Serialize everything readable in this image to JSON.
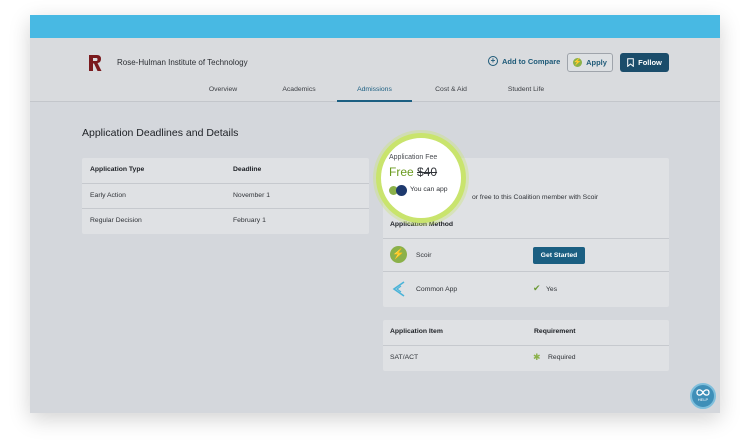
{
  "header": {
    "school_name": "Rose-Hulman Institute of Technology",
    "add_to_compare": "Add to Compare",
    "apply": "Apply",
    "follow": "Follow"
  },
  "tabs": [
    "Overview",
    "Academics",
    "Admissions",
    "Cost & Aid",
    "Student Life"
  ],
  "active_tab": "Admissions",
  "section_title": "Application Deadlines and Details",
  "deadlines": {
    "headers": [
      "Application Type",
      "Deadline"
    ],
    "rows": [
      [
        "Early Action",
        "November 1"
      ],
      [
        "Regular Decision",
        "February 1"
      ]
    ]
  },
  "fee": {
    "label": "Application Fee",
    "free": "Free",
    "old_price": "$40",
    "note_visible": "You can app",
    "note_rest": "or free to this Coalition member with Scoir"
  },
  "method": {
    "header": "Application Method",
    "rows": [
      {
        "name": "Scoir",
        "action": "Get Started"
      },
      {
        "name": "Common App",
        "value": "Yes"
      }
    ]
  },
  "items": {
    "headers": [
      "Application Item",
      "Requirement"
    ],
    "rows": [
      [
        "SAT/ACT",
        "Required"
      ]
    ]
  },
  "help_label": "HELP",
  "colors": {
    "top_bar": "#48b9e3",
    "primary": "#1b5f82",
    "highlight": "#c9e46d"
  }
}
